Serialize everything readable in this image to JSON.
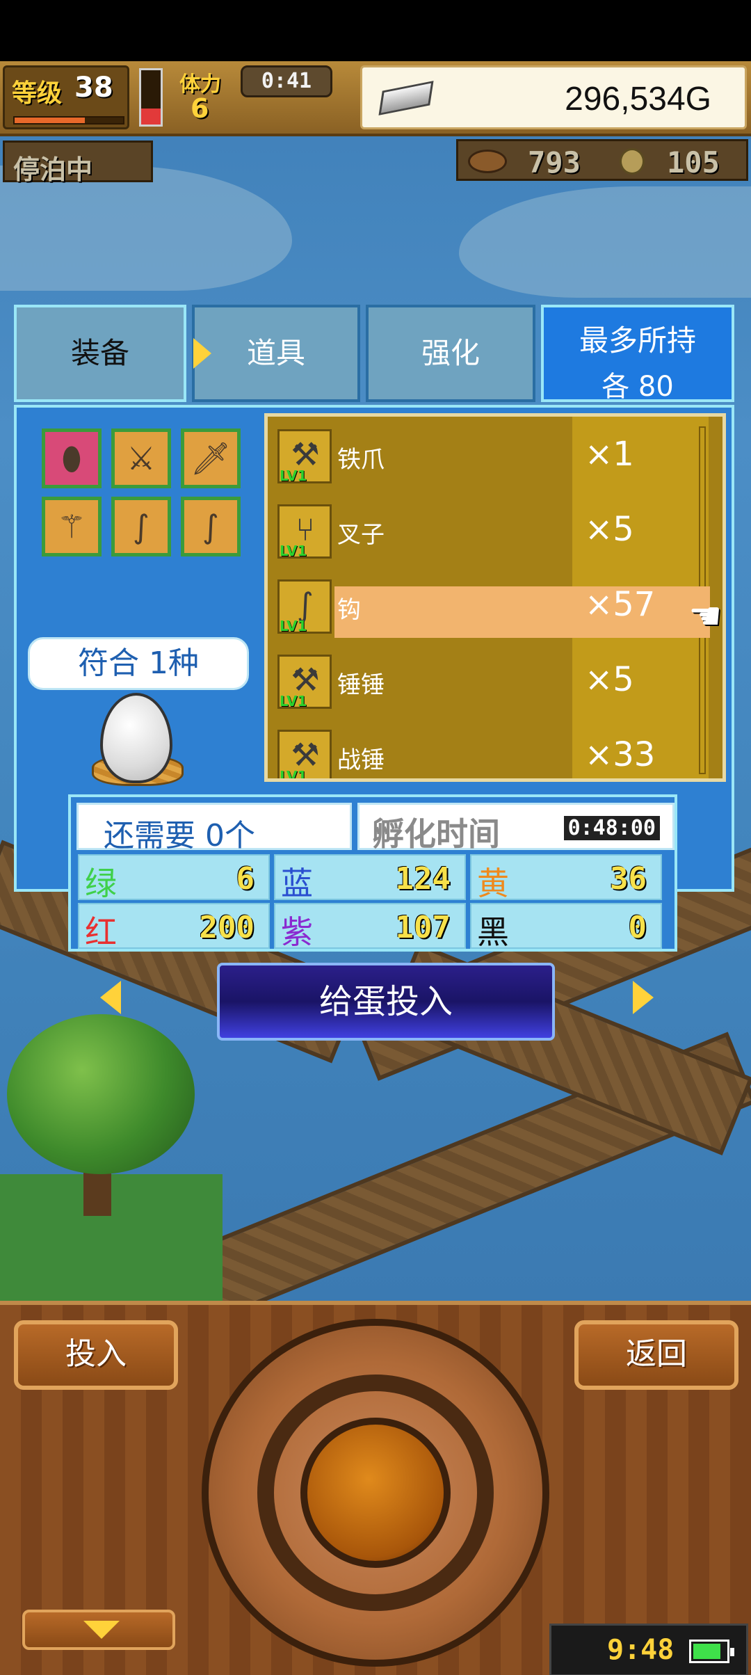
{
  "hud": {
    "level_label": "等级",
    "level": "38",
    "stamina_label": "体力",
    "stamina": "6",
    "timer": "0:41",
    "gold": "296,534G"
  },
  "status": {
    "anchor_label": "停泊中",
    "resource_1": "793",
    "resource_2": "105"
  },
  "tabs": {
    "equipment": "装备",
    "items": "道具",
    "upgrade": "强化"
  },
  "max_hold": {
    "title": "最多所持",
    "value": "各 80"
  },
  "match_label": "符合 1种",
  "item_list": [
    {
      "name": "铁爪",
      "qty": "×1",
      "lv": "LV1",
      "selected": false,
      "icon": "claw-icon"
    },
    {
      "name": "叉子",
      "qty": "×5",
      "lv": "LV1",
      "selected": false,
      "icon": "fork-icon"
    },
    {
      "name": "钩",
      "qty": "×57",
      "lv": "LV1",
      "selected": true,
      "icon": "hook-icon"
    },
    {
      "name": "锤锤",
      "qty": "×5",
      "lv": "LV1",
      "selected": false,
      "icon": "hammer-icon"
    },
    {
      "name": "战锤",
      "qty": "×33",
      "lv": "LV1",
      "selected": false,
      "icon": "warhammer-icon"
    }
  ],
  "stats": {
    "need_label": "还需要 0个",
    "hatch_label": "孵化时间",
    "hatch_time": "0:48:00",
    "green": {
      "name": "绿",
      "value": "6"
    },
    "blue": {
      "name": "蓝",
      "value": "124"
    },
    "yellow": {
      "name": "黄",
      "value": "36"
    },
    "red": {
      "name": "红",
      "value": "200"
    },
    "purple": {
      "name": "紫",
      "value": "107"
    },
    "black": {
      "name": "黑",
      "value": "0"
    }
  },
  "feed_button": "给蛋投入",
  "controller": {
    "put_label": "投入",
    "back_label": "返回"
  },
  "clock": "9:48",
  "levels": {
    "exp_fraction": 0.65,
    "stamina_fraction": 0.3,
    "battery_fraction": 0.85
  },
  "colors": {
    "panel": "#2e80d2",
    "border": "#9ae7f7",
    "highlight": "#f2b46e"
  }
}
